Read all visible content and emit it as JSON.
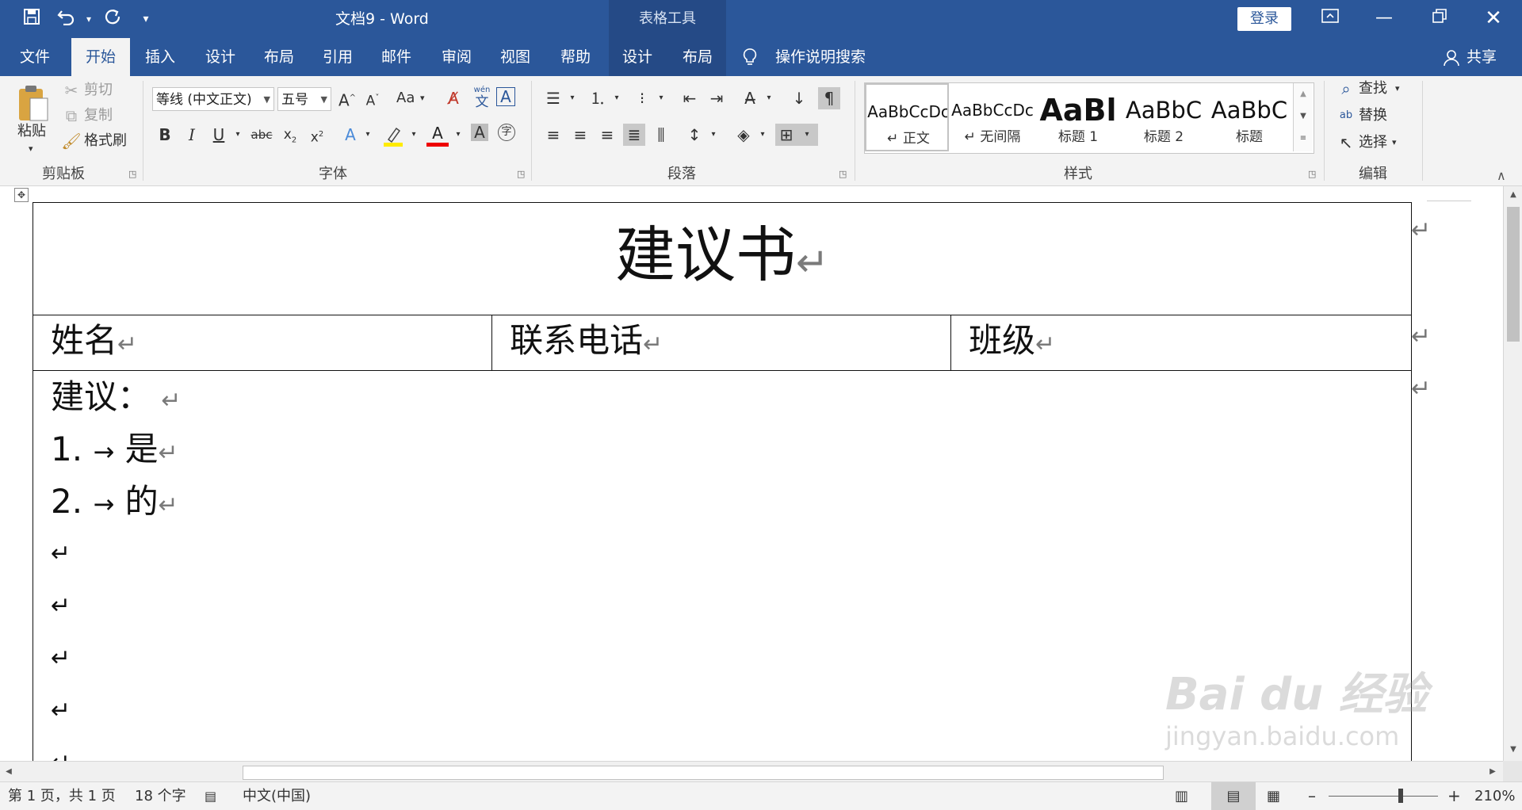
{
  "window": {
    "doc_title": "文档9  -  Word",
    "context_title": "表格工具",
    "login_label": "登录"
  },
  "quick_access": {
    "save_icon": "save-icon",
    "undo_icon": "undo-icon",
    "redo_icon": "redo-icon",
    "customize_icon": "customize-icon"
  },
  "tabs": [
    {
      "label": "文件"
    },
    {
      "label": "开始"
    },
    {
      "label": "插入"
    },
    {
      "label": "设计"
    },
    {
      "label": "布局"
    },
    {
      "label": "引用"
    },
    {
      "label": "邮件"
    },
    {
      "label": "审阅"
    },
    {
      "label": "视图"
    },
    {
      "label": "帮助"
    },
    {
      "label": "设计"
    },
    {
      "label": "布局"
    }
  ],
  "tell_me": "操作说明搜索",
  "share_label": "共享",
  "clipboard": {
    "label": "剪贴板",
    "paste": "粘贴",
    "cut": "剪切",
    "copy": "复制",
    "format_painter": "格式刷"
  },
  "font": {
    "label": "字体",
    "font_name": "等线 (中文正文)",
    "font_size": "五号",
    "case_label": "Aa",
    "pinyin_top": "wén",
    "pinyin_char": "文"
  },
  "paragraph": {
    "label": "段落"
  },
  "styles": {
    "label": "样式",
    "items": [
      {
        "sample": "AaBbCcDc",
        "name": "↵ 正文"
      },
      {
        "sample": "AaBbCcDc",
        "name": "↵ 无间隔"
      },
      {
        "sample": "AaBl",
        "name": "标题 1"
      },
      {
        "sample": "AaBbC",
        "name": "标题 2"
      },
      {
        "sample": "AaBbC",
        "name": "标题"
      }
    ]
  },
  "editing": {
    "label": "编辑",
    "find": "查找",
    "replace": "替换",
    "select": "选择"
  },
  "document": {
    "title": "建议书",
    "name_label": "姓名",
    "phone_label": "联系电话",
    "class_label": "班级",
    "suggestion_label": "建议：",
    "items": [
      {
        "num": "1.",
        "text": "是"
      },
      {
        "num": "2.",
        "text": "的"
      }
    ],
    "para_mark": "↵"
  },
  "status": {
    "page": "第 1 页，共 1 页",
    "words": "18 个字",
    "language": "中文(中国)",
    "zoom": "210%"
  },
  "watermark": {
    "brand": "Bai du 经验",
    "url": "jingyan.baidu.com"
  }
}
